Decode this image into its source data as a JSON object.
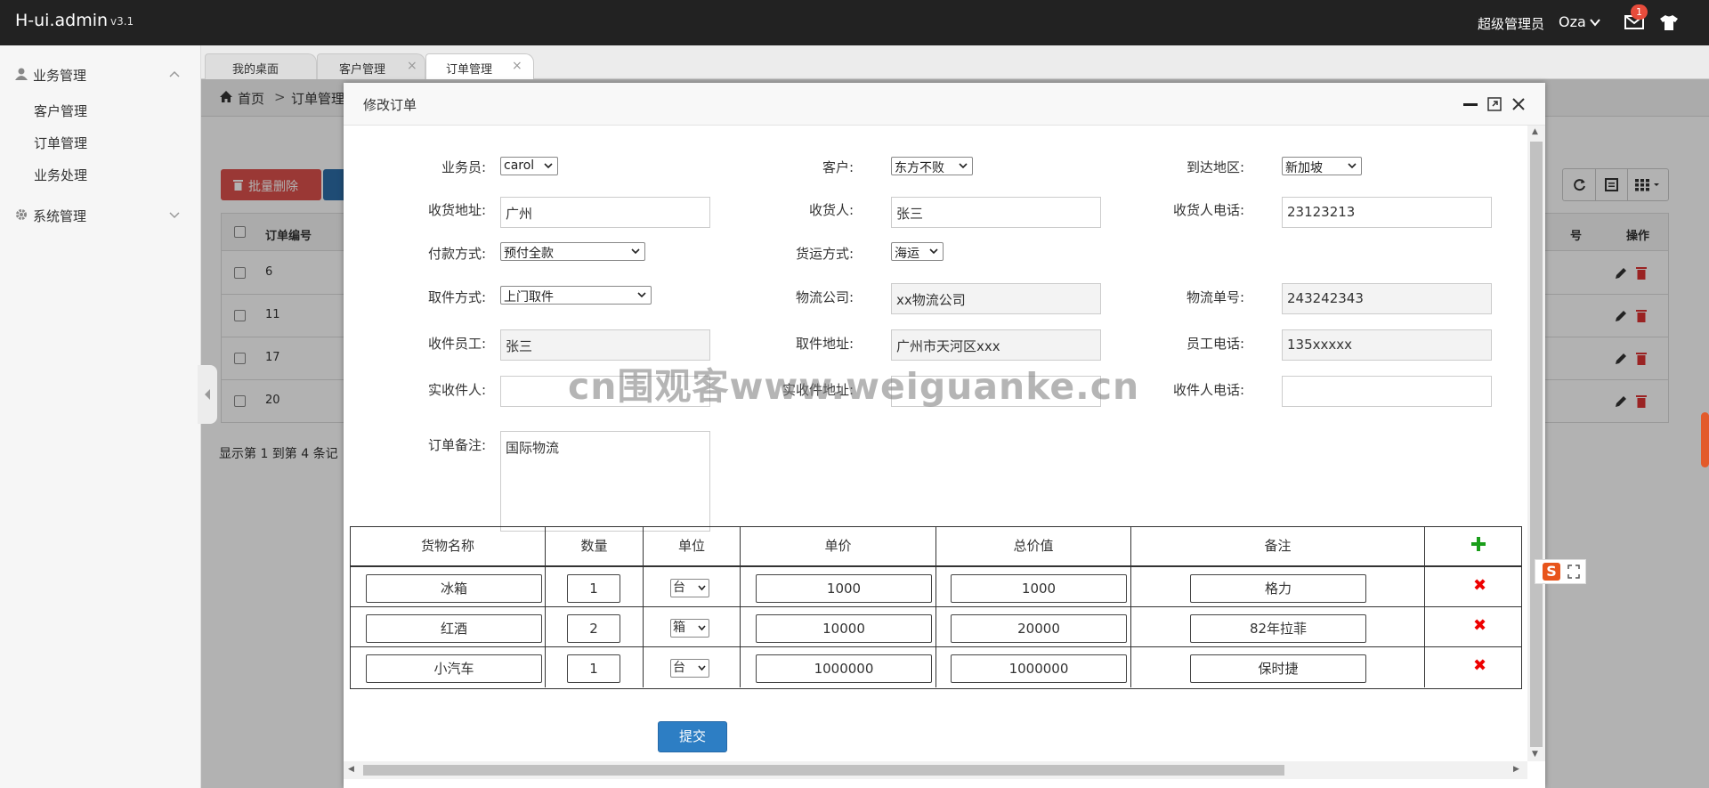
{
  "header": {
    "logo": "H-ui.admin",
    "version": "v3.1",
    "user_role": "超级管理员",
    "user_name": "Oza",
    "mail_count": "1"
  },
  "sidebar": {
    "groups": [
      {
        "label": "业务管理",
        "items": [
          "客户管理",
          "订单管理",
          "业务处理"
        ]
      },
      {
        "label": "系统管理"
      }
    ]
  },
  "tabs": [
    {
      "label": "我的桌面"
    },
    {
      "label": "客户管理"
    },
    {
      "label": "订单管理"
    }
  ],
  "breadcrumb": {
    "home": "首页",
    "sep": ">",
    "current": "订单管理"
  },
  "toolbar": {
    "batch_delete": "批量删除"
  },
  "bg_table": {
    "headers": {
      "order_no": "订单编号",
      "seq": "号",
      "actions": "操作"
    },
    "rows": [
      {
        "id": "6"
      },
      {
        "id": "11"
      },
      {
        "id": "17"
      },
      {
        "id": "20"
      }
    ],
    "pager": "显示第 1 到第 4 条记"
  },
  "modal": {
    "title": "修改订单",
    "form": {
      "salesman": {
        "label": "业务员:",
        "value": "carol"
      },
      "customer": {
        "label": "客户:",
        "value": "东方不败"
      },
      "region": {
        "label": "到达地区:",
        "value": "新加坡"
      },
      "address": {
        "label": "收货地址:",
        "value": "广州"
      },
      "receiver": {
        "label": "收货人:",
        "value": "张三"
      },
      "receiver_phone": {
        "label": "收货人电话:",
        "value": "23123213"
      },
      "payment": {
        "label": "付款方式:",
        "value": "预付全款"
      },
      "shipping": {
        "label": "货运方式:",
        "value": "海运"
      },
      "pickup": {
        "label": "取件方式:",
        "value": "上门取件"
      },
      "logistics_company": {
        "label": "物流公司:",
        "value": "xx物流公司"
      },
      "tracking_no": {
        "label": "物流单号:",
        "value": "243242343"
      },
      "pickup_staff": {
        "label": "收件员工:",
        "value": "张三"
      },
      "pickup_address": {
        "label": "取件地址:",
        "value": "广州市天河区xxx"
      },
      "staff_phone": {
        "label": "员工电话:",
        "value": "135xxxxx"
      },
      "actual_receiver": {
        "label": "实收件人:",
        "value": ""
      },
      "actual_address": {
        "label": "实收件地址:",
        "value": ""
      },
      "actual_phone": {
        "label": "收件人电话:",
        "value": ""
      },
      "remark": {
        "label": "订单备注:",
        "value": "国际物流"
      }
    },
    "goods": {
      "headers": [
        "货物名称",
        "数量",
        "单位",
        "单价",
        "总价值",
        "备注"
      ],
      "rows": [
        {
          "name": "冰箱",
          "qty": "1",
          "unit": "台",
          "price": "1000",
          "total": "1000",
          "note": "格力"
        },
        {
          "name": "红酒",
          "qty": "2",
          "unit": "箱",
          "price": "10000",
          "total": "20000",
          "note": "82年拉菲"
        },
        {
          "name": "小汽车",
          "qty": "1",
          "unit": "台",
          "price": "1000000",
          "total": "1000000",
          "note": "保时捷"
        }
      ],
      "delete_glyph": "✖"
    },
    "submit_label": "提交"
  },
  "watermark": "cn围观客www.weiguanke.cn",
  "ime_logo": "S",
  "colors": {
    "topbar": "#222222",
    "danger": "#dd514c",
    "primary": "#2d7ec4",
    "add": "#1a9e1a",
    "delete": "#ee0000"
  }
}
